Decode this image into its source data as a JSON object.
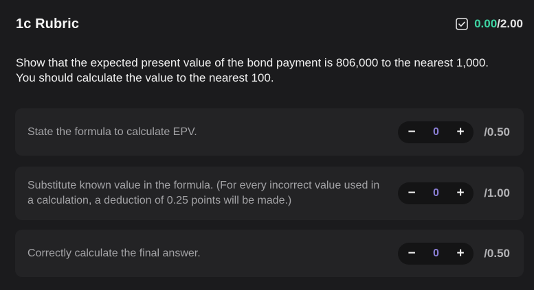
{
  "header": {
    "title": "1c Rubric",
    "score_current": "0.00",
    "score_separator": "/",
    "score_total": "2.00",
    "check_icon": "checkbox-check-icon"
  },
  "question": {
    "line1": "Show that the expected present value of the bond payment is 806,000 to the nearest 1,000.",
    "line2": "You should calculate the value to the nearest 100."
  },
  "criteria": [
    {
      "text": "State the formula to calculate EPV.",
      "value": "0",
      "max": "/0.50",
      "minus": "−",
      "plus": "+"
    },
    {
      "text": "Substitute known value in the formula. (For every incorrect value used in a calculation, a deduction of 0.25 points will be made.)",
      "value": "0",
      "max": "/1.00",
      "minus": "−",
      "plus": "+"
    },
    {
      "text": "Correctly calculate the final answer.",
      "value": "0",
      "max": "/0.50",
      "minus": "−",
      "plus": "+"
    }
  ],
  "colors": {
    "background": "#1b1b1d",
    "card": "#232325",
    "score_accent": "#3ed4a3",
    "stepper_value": "#8b7fd6"
  }
}
